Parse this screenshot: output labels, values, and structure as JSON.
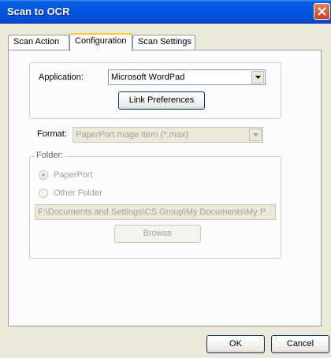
{
  "window": {
    "title": "Scan to OCR"
  },
  "tabs": [
    {
      "label": "Scan Action"
    },
    {
      "label": "Configuration"
    },
    {
      "label": "Scan Settings"
    }
  ],
  "config": {
    "application_label": "Application:",
    "application_value": "Microsoft WordPad",
    "link_preferences_label": "Link Preferences",
    "format_label": "Format:",
    "format_value": "PaperPort mage Item (*.max)",
    "folder_group_label": "Folder:",
    "radio_paperport_label": "PaperPort",
    "radio_other_folder_label": "Other Folder",
    "folder_path": "F:\\Documents and Settings\\CS Group\\My Documents\\My P",
    "browse_label": "Browse"
  },
  "footer": {
    "ok_label": "OK",
    "cancel_label": "Cancel"
  },
  "colors": {
    "titlebar": "#0054e3",
    "close_button": "#d8502b",
    "dialog_face": "#ece9d8",
    "tab_highlight": "#ffc83c"
  },
  "icons": {
    "close": "close-icon",
    "dropdown": "chevron-down-icon"
  }
}
